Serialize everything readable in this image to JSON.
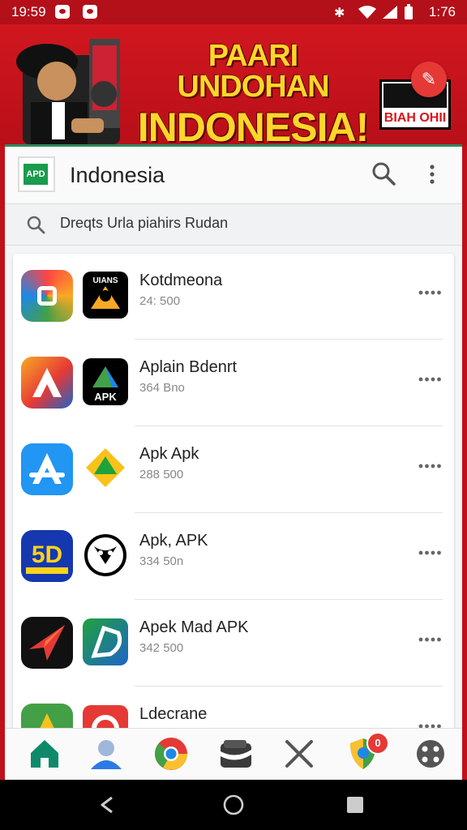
{
  "status_bar": {
    "time_left": "19:59",
    "time_right": "1:76"
  },
  "banner": {
    "headline_line1": "PAARI UNDOHAN",
    "headline_line2": "INDONESIA!",
    "badge_text": "BIAH OHII",
    "action_icon": "hammer-icon"
  },
  "app_header": {
    "logo_text": "APD",
    "title": "Indonesia",
    "search_icon": "search-icon",
    "more_icon": "more-vertical-icon"
  },
  "search": {
    "query": "Dreqts Urla piahirs Rudan"
  },
  "apps": [
    {
      "name": "Kotdmeona",
      "size": "24: 500"
    },
    {
      "name": "Aplain Bdenrt",
      "size": "364 Bno"
    },
    {
      "name": "Apk Apk",
      "size": "288 500"
    },
    {
      "name": "Apk, APK",
      "size": "334 50n"
    },
    {
      "name": "Apek Mad APK",
      "size": "342 500"
    },
    {
      "name": "Ldecrane",
      "size": ""
    }
  ],
  "dock": [
    {
      "icon": "home-icon"
    },
    {
      "icon": "contacts-icon"
    },
    {
      "icon": "chrome-icon"
    },
    {
      "icon": "wallet-icon"
    },
    {
      "icon": "tools-icon"
    },
    {
      "icon": "shield-icon",
      "badge": "0"
    },
    {
      "icon": "settings-icon"
    }
  ],
  "colors": {
    "brand_red": "#c0111a",
    "headline_yellow": "#ffd62a",
    "accent_green": "#1a9b4d"
  }
}
